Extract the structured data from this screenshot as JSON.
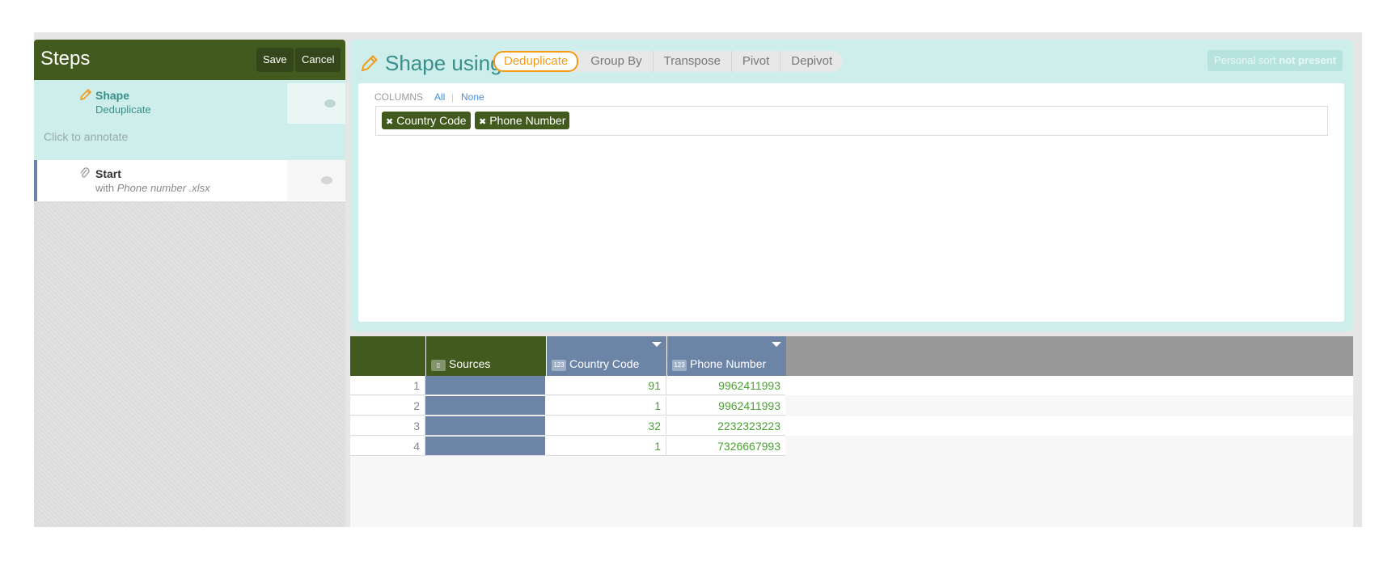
{
  "steps": {
    "title": "Steps",
    "save_label": "Save",
    "cancel_label": "Cancel",
    "items": [
      {
        "name": "Shape",
        "sub": "Deduplicate",
        "annotate_placeholder": "Click to annotate"
      },
      {
        "name": "Start",
        "sub_prefix": "with",
        "sub_file": "Phone number .xlsx"
      }
    ]
  },
  "shape": {
    "title": "Shape using",
    "tabs": [
      "Deduplicate",
      "Group By",
      "Transpose",
      "Pivot",
      "Depivot"
    ],
    "active_tab": "Deduplicate",
    "sort_label": "Personal sort",
    "sort_state": "not present",
    "columns_label": "COLUMNS",
    "all_link": "All",
    "sep": "|",
    "none_link": "None",
    "selected_columns": [
      "Country Code",
      "Phone Number"
    ]
  },
  "table": {
    "columns": [
      {
        "label": "Sources",
        "type_icon": "document-icon"
      },
      {
        "label": "Country Code",
        "type": "123"
      },
      {
        "label": "Phone Number",
        "type": "123"
      }
    ],
    "rows": [
      {
        "n": "1",
        "country_code": "91",
        "phone": "9962411993"
      },
      {
        "n": "2",
        "country_code": "1",
        "phone": "9962411993"
      },
      {
        "n": "3",
        "country_code": "32",
        "phone": "2232323223"
      },
      {
        "n": "4",
        "country_code": "1",
        "phone": "7326667993"
      }
    ]
  },
  "colors": {
    "header_green": "#435a1f",
    "teal_panel": "#cdeeea",
    "accent_orange": "#f49b16",
    "column_blue": "#6c84a6",
    "number_green": "#4aa232"
  }
}
